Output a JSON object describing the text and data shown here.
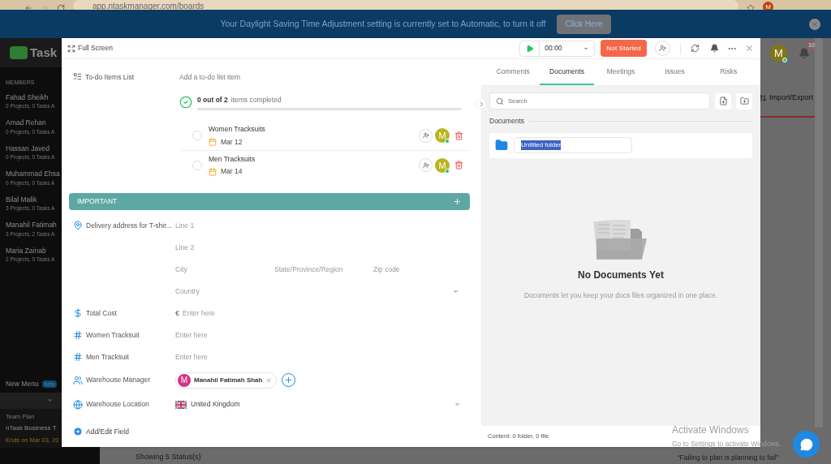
{
  "browser": {
    "url": "app.ntaskmanager.com/boards",
    "profile_initial": "M"
  },
  "banner": {
    "message": "Your Daylight Saving Time Adjustment setting is currently set to Automatic, to turn it off",
    "button": "Click Here"
  },
  "sidebar": {
    "logo": "Task",
    "section": "MEMBERS",
    "members": [
      {
        "name": "Fahad Sheikh",
        "info": "0 Projects, 0 Tasks A"
      },
      {
        "name": "Amad Rehan",
        "info": "0 Projects, 0 Tasks A"
      },
      {
        "name": "Hassan Javed",
        "info": "0 Projects, 0 Tasks A"
      },
      {
        "name": "Muhammad Ehsa",
        "info": "0 Projects, 0 Tasks A"
      },
      {
        "name": "Bilal Malik",
        "info": "3 Projects, 0 Tasks A"
      },
      {
        "name": "Manahil Fatimah",
        "info": "3 Projects, 2 Tasks A"
      },
      {
        "name": "Maria Zainab",
        "info": "2 Projects, 0 Tasks A"
      }
    ],
    "new_menu": "New Menu",
    "beta": "beta",
    "plan_label": "Team Plan",
    "plan_name": "nTask Business T",
    "plan_expiry": "Ends on Mar 03, 20"
  },
  "board": {
    "avatar": "M",
    "notifications": "10",
    "import_export": "Import/Export",
    "status_count": "Showing 5 Status(s)",
    "quote": "“Failing to plan is planning to fail”"
  },
  "modal": {
    "full_screen": "Full Screen",
    "timer": "00:00",
    "status": "Not Started",
    "todo": {
      "label": "To-do Items List",
      "placeholder": "Add a to-do list item",
      "progress_count": "0 out of 2",
      "progress_text": "items completed",
      "level": 0,
      "items": [
        {
          "title": "Women Tracksuits",
          "date": "Mar 12",
          "checked": false,
          "assignee": "M"
        },
        {
          "title": "Men Tracksuits",
          "date": "Mar 14",
          "checked": false,
          "assignee": "M"
        }
      ]
    },
    "section": "IMPORTANT",
    "fields": [
      {
        "kind": "address",
        "label": "Delivery address for T-shir...",
        "placeholders": [
          "Line 1",
          "Line 2",
          "City",
          "State/Province/Region",
          "Zip code",
          "Country"
        ]
      },
      {
        "kind": "currency",
        "label": "Total Cost",
        "symbol": "€",
        "placeholder": "Enter here"
      },
      {
        "kind": "number",
        "label": "Women Tracksuit",
        "placeholder": "Enter here"
      },
      {
        "kind": "number",
        "label": "Men Tracksuit",
        "placeholder": "Enter here"
      },
      {
        "kind": "people",
        "label": "Warehouse Manager",
        "people": [
          {
            "initial": "M",
            "name": "Manahil Fatimah Shah"
          }
        ]
      },
      {
        "kind": "country",
        "label": "Warehouse Location",
        "value": "United Kingdom"
      }
    ],
    "add_field": "Add/Edit Field",
    "tabs": [
      {
        "label": "Comments",
        "selected": false
      },
      {
        "label": "Documents",
        "selected": true
      },
      {
        "label": "Meetings",
        "selected": false
      },
      {
        "label": "Issues",
        "selected": false
      },
      {
        "label": "Risks",
        "selected": false
      }
    ],
    "search": {
      "placeholder": "Search"
    },
    "documents_heading": "Documents",
    "folder": {
      "name": "Untitled folder"
    },
    "empty": {
      "title": "No Documents Yet",
      "description": "Documents let you keep your docs files organized in one place."
    },
    "footer": "Content: 0 folder, 0 file"
  },
  "windows_notice": {
    "title": "Activate Windows",
    "text": "Go to Settings to activate Windows."
  }
}
